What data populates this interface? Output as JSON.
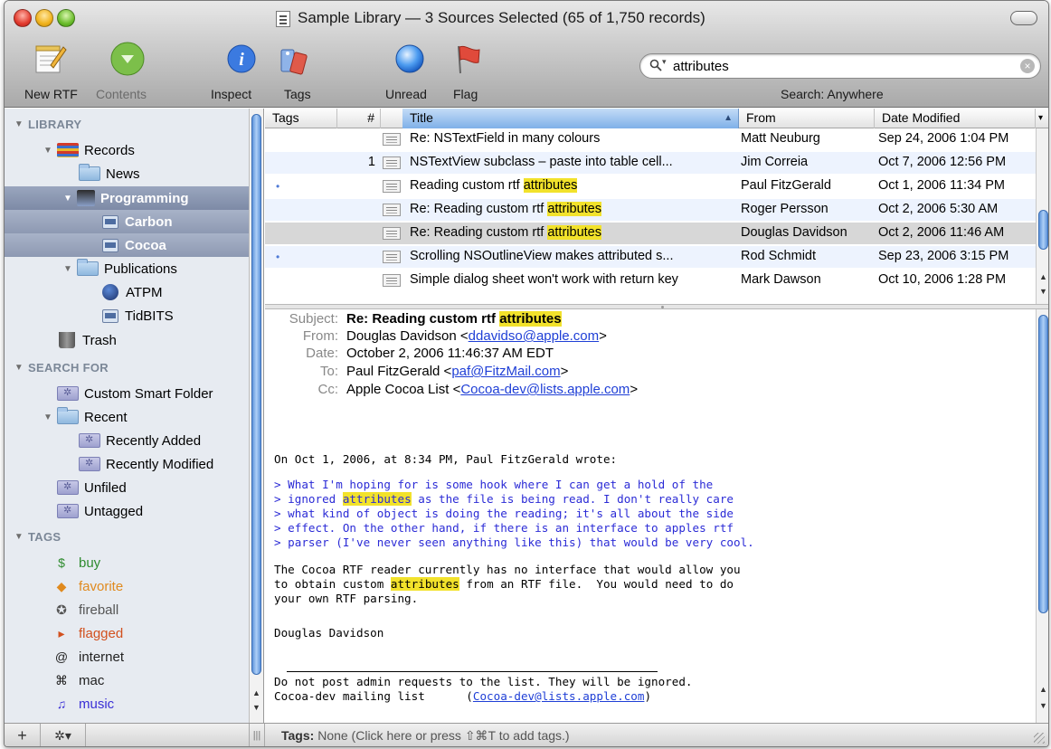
{
  "window": {
    "title": "Sample Library — 3 Sources Selected (65 of 1,750 records)"
  },
  "toolbar": {
    "new_rtf": "New RTF",
    "contents": "Contents",
    "inspect": "Inspect",
    "tags": "Tags",
    "unread": "Unread",
    "flag": "Flag",
    "search_value": "attributes",
    "search_scope": "Search: Anywhere"
  },
  "sidebar": {
    "library_header": "LIBRARY",
    "records": "Records",
    "news": "News",
    "programming": "Programming",
    "carbon": "Carbon",
    "cocoa": "Cocoa",
    "publications": "Publications",
    "atpm": "ATPM",
    "tidbits": "TidBITS",
    "trash": "Trash",
    "search_header": "SEARCH FOR",
    "custom_smart_folder": "Custom Smart Folder",
    "recent": "Recent",
    "recently_added": "Recently Added",
    "recently_modified": "Recently Modified",
    "unfiled": "Unfiled",
    "untagged": "Untagged",
    "tags_header": "TAGS",
    "tags": [
      {
        "glyph": "$",
        "label": "buy",
        "color": "#2e8b2e"
      },
      {
        "glyph": "◆",
        "label": "favorite",
        "color": "#e08a1e"
      },
      {
        "glyph": "✪",
        "label": "fireball",
        "color": "#555555"
      },
      {
        "glyph": "▸",
        "label": "flagged",
        "color": "#d2501e"
      },
      {
        "glyph": "@",
        "label": "internet",
        "color": "#222222"
      },
      {
        "glyph": "⌘",
        "label": "mac",
        "color": "#222222"
      },
      {
        "glyph": "♫",
        "label": "music",
        "color": "#3a2fd6"
      }
    ]
  },
  "list": {
    "headers": {
      "tags": "Tags",
      "num": "#",
      "title": "Title",
      "from": "From",
      "date": "Date Modified"
    },
    "rows": [
      {
        "dot": "",
        "num": "",
        "title_pre": "Re: NSTextField in many colours",
        "title_hl": "",
        "from": "Matt Neuburg",
        "date": "Sep 24, 2006 1:04 PM"
      },
      {
        "dot": "",
        "num": "1",
        "title_pre": "NSTextView subclass – paste into table cell...",
        "title_hl": "",
        "from": "Jim Correia",
        "date": "Oct 7, 2006 12:56 PM"
      },
      {
        "dot": "•",
        "num": "",
        "title_pre": "Reading custom rtf ",
        "title_hl": "attributes",
        "from": "Paul FitzGerald",
        "date": "Oct 1, 2006 11:34 PM"
      },
      {
        "dot": "",
        "num": "",
        "title_pre": "Re: Reading custom rtf ",
        "title_hl": "attributes",
        "from": "Roger Persson",
        "date": "Oct 2, 2006 5:30 AM"
      },
      {
        "dot": "",
        "num": "",
        "title_pre": "Re: Reading custom rtf ",
        "title_hl": "attributes",
        "from": "Douglas Davidson",
        "date": "Oct 2, 2006 11:46 AM"
      },
      {
        "dot": "•",
        "num": "",
        "title_pre": "Scrolling NSOutlineView makes attributed s...",
        "title_hl": "",
        "from": "Rod Schmidt",
        "date": "Sep 23, 2006 3:15 PM"
      },
      {
        "dot": "",
        "num": "",
        "title_pre": "Simple dialog sheet won't work with return key",
        "title_hl": "",
        "from": "Mark Dawson",
        "date": "Oct 10, 2006 1:28 PM"
      }
    ]
  },
  "message": {
    "subject_key": "Subject:",
    "subject_pre": "Re: Reading custom rtf ",
    "subject_hl": "attributes",
    "from_key": "From:",
    "from_name": "Douglas Davidson <",
    "from_email": "ddavidso@apple.com",
    "from_close": ">",
    "date_key": "Date:",
    "date_val": "October 2, 2006 11:46:37 AM EDT",
    "to_key": "To:",
    "to_name": "Paul FitzGerald <",
    "to_email": "paf@FitzMail.com",
    "to_close": ">",
    "cc_key": "Cc:",
    "cc_name": "Apple Cocoa List <",
    "cc_email": "Cocoa-dev@lists.apple.com",
    "cc_close": ">",
    "intro": "On Oct 1, 2006, at 8:34 PM, Paul FitzGerald wrote:",
    "q1": "> What I'm hoping for is some hook where I can get a hold of the",
    "q2_pre": "> ignored ",
    "q2_hl": "attributes",
    "q2_post": " as the file is being read. I don't really care",
    "q3": "> what kind of object is doing the reading; it's all about the side",
    "q4": "> effect. On the other hand, if there is an interface to apples rtf",
    "q5": "> parser (I've never seen anything like this) that would be very cool.",
    "b1": "The Cocoa RTF reader currently has no interface that would allow you",
    "b2_pre": "to obtain custom ",
    "b2_hl": "attributes",
    "b2_post": " from an RTF file.  You would need to do",
    "b3": "your own RTF parsing.",
    "sig": "Douglas Davidson",
    "f1": "Do not post admin requests to the list. They will be ignored.",
    "f2_pre": "Cocoa-dev mailing list      (",
    "f2_link": "Cocoa-dev@lists.apple.com",
    "f2_post": ")"
  },
  "bottom": {
    "add": "+",
    "gear": "✲▾",
    "grip": "|||",
    "tags_label": "Tags:",
    "tags_text": " None (Click here or press ⇧⌘T to add tags.)"
  }
}
